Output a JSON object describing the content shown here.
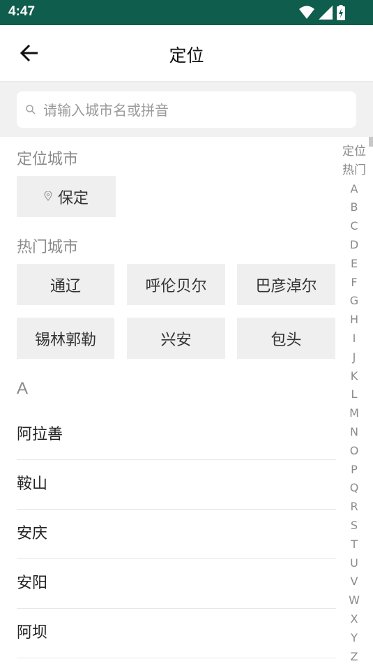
{
  "status_bar": {
    "time": "4:47",
    "icons": [
      "wifi-icon",
      "signal-icon",
      "battery-charging-icon"
    ]
  },
  "app_bar": {
    "title": "定位",
    "back_icon": "arrow-left-icon"
  },
  "search": {
    "placeholder": "请输入城市名或拼音",
    "value": ""
  },
  "locate_section": {
    "title": "定位城市",
    "city": "保定"
  },
  "hot_section": {
    "title": "热门城市",
    "cities": [
      "通辽",
      "呼伦贝尔",
      "巴彦淖尔",
      "锡林郭勒",
      "兴安",
      "包头"
    ]
  },
  "city_list": {
    "letter": "A",
    "cities": [
      "阿拉善",
      "鞍山",
      "安庆",
      "安阳",
      "阿坝"
    ]
  },
  "index_bar": [
    "定位",
    "热门",
    "A",
    "B",
    "C",
    "D",
    "E",
    "F",
    "G",
    "H",
    "I",
    "J",
    "K",
    "L",
    "M",
    "N",
    "O",
    "P",
    "Q",
    "R",
    "S",
    "T",
    "U",
    "V",
    "W",
    "X",
    "Y",
    "Z"
  ]
}
